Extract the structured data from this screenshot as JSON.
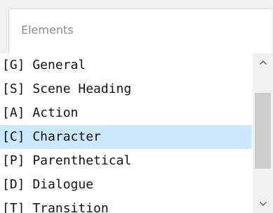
{
  "panel": {
    "title": "Elements"
  },
  "elements_list": {
    "selected_index": 3,
    "items": [
      {
        "label": "[G] General"
      },
      {
        "label": "[S] Scene Heading"
      },
      {
        "label": "[A] Action"
      },
      {
        "label": "[C] Character"
      },
      {
        "label": "[P] Parenthetical"
      },
      {
        "label": "[D] Dialogue"
      },
      {
        "label": "[T] Transition"
      }
    ]
  },
  "scrollbar": {
    "up_icon": "chevron-up-icon",
    "down_icon": "chevron-down-icon"
  },
  "colors": {
    "selection": "#cce8ff",
    "title_text": "#8a8a8a",
    "thumb": "#cdcdcd"
  }
}
